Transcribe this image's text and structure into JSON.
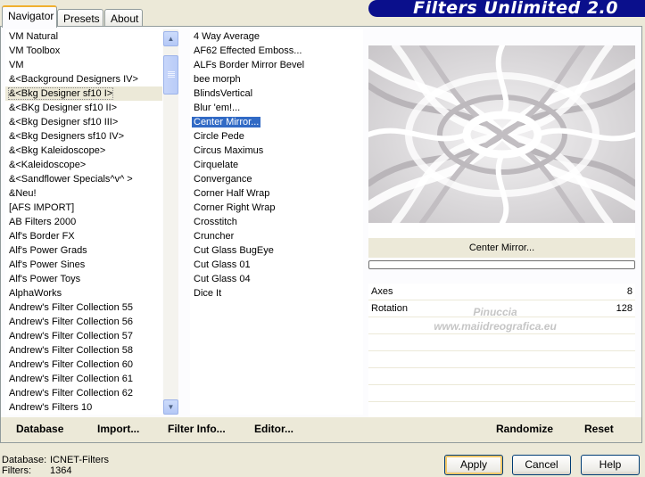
{
  "tabs": [
    "Navigator",
    "Presets",
    "About"
  ],
  "banner_title": "Filters Unlimited 2.0",
  "categories": [
    "VM Natural",
    "VM Toolbox",
    "VM",
    "&<Background Designers IV>",
    "&<Bkg Designer sf10 I>",
    "&<BKg Designer sf10 II>",
    "&<Bkg Designer sf10 III>",
    "&<Bkg Designers sf10 IV>",
    "&<Bkg Kaleidoscope>",
    "&<Kaleidoscope>",
    "&<Sandflower Specials^v^ >",
    "&Neu!",
    "[AFS IMPORT]",
    "AB Filters 2000",
    "Alf's Border FX",
    "Alf's Power Grads",
    "Alf's Power Sines",
    "Alf's Power Toys",
    "AlphaWorks",
    "Andrew's Filter Collection 55",
    "Andrew's Filter Collection 56",
    "Andrew's Filter Collection 57",
    "Andrew's Filter Collection 58",
    "Andrew's Filter Collection 60",
    "Andrew's Filter Collection 61",
    "Andrew's Filter Collection 62",
    "Andrew's Filters 10"
  ],
  "selected_category": "&<Bkg Designer sf10 I>",
  "filters": [
    "4 Way Average",
    "AF62 Effected Emboss...",
    "ALFs Border Mirror Bevel",
    "bee morph",
    "BlindsVertical",
    "Blur 'em!...",
    "Center Mirror...",
    "Circle Pede",
    "Circus Maximus",
    "Cirquelate",
    "Convergance",
    "Corner Half Wrap",
    "Corner Right Wrap",
    "Crosstitch",
    "Cruncher",
    "Cut Glass  BugEye",
    "Cut Glass 01",
    "Cut Glass 04",
    "Dice It"
  ],
  "selected_filter": "Center Mirror...",
  "effect_name": "Center Mirror...",
  "progress_fraction": 0,
  "parameters": [
    {
      "name": "Axes",
      "value": "8"
    },
    {
      "name": "Rotation",
      "value": "128"
    }
  ],
  "watermark": {
    "line1": "Pinuccia",
    "line2": "www.maiidreografica.eu"
  },
  "toolbar": {
    "database": "Database",
    "import": "Import...",
    "filter_info": "Filter Info...",
    "editor": "Editor...",
    "randomize": "Randomize",
    "reset": "Reset"
  },
  "db_info": {
    "database_label": "Database:",
    "database_value": "ICNET-Filters",
    "filters_label": "Filters:",
    "filters_value": "1364"
  },
  "buttons": {
    "apply": "Apply",
    "cancel": "Cancel",
    "help": "Help"
  },
  "colors": {
    "banner": "#0a0f8c",
    "selection": "#316ac5",
    "window": "#ece9d8"
  }
}
